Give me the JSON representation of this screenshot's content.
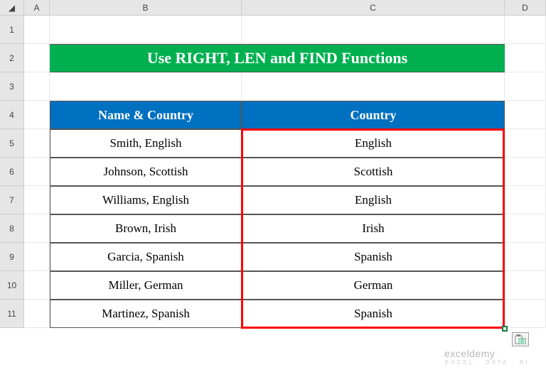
{
  "columns": {
    "corner": "◢",
    "A": "A",
    "B": "B",
    "C": "C",
    "D": "D"
  },
  "rows": [
    "1",
    "2",
    "3",
    "4",
    "5",
    "6",
    "7",
    "8",
    "9",
    "10",
    "11"
  ],
  "title": "Use RIGHT, LEN and FIND Functions",
  "headers": {
    "nameCountry": "Name & Country",
    "country": "Country"
  },
  "data": [
    {
      "nc": "Smith, English",
      "c": "English"
    },
    {
      "nc": "Johnson, Scottish",
      "c": "Scottish"
    },
    {
      "nc": "Williams, English",
      "c": "English"
    },
    {
      "nc": "Brown, Irish",
      "c": "Irish"
    },
    {
      "nc": "Garcia, Spanish",
      "c": "Spanish"
    },
    {
      "nc": "Miller, German",
      "c": "German"
    },
    {
      "nc": "Martinez, Spanish",
      "c": "Spanish"
    }
  ],
  "watermark": {
    "main": "exceldemy",
    "sub": "EXCEL · DATA · BI"
  },
  "chart_data": {
    "type": "table",
    "title": "Use RIGHT, LEN and FIND Functions",
    "columns": [
      "Name & Country",
      "Country"
    ],
    "rows": [
      [
        "Smith, English",
        "English"
      ],
      [
        "Johnson, Scottish",
        "Scottish"
      ],
      [
        "Williams, English",
        "English"
      ],
      [
        "Brown, Irish",
        "Irish"
      ],
      [
        "Garcia, Spanish",
        "Spanish"
      ],
      [
        "Miller, German",
        "German"
      ],
      [
        "Martinez, Spanish",
        "Spanish"
      ]
    ]
  }
}
